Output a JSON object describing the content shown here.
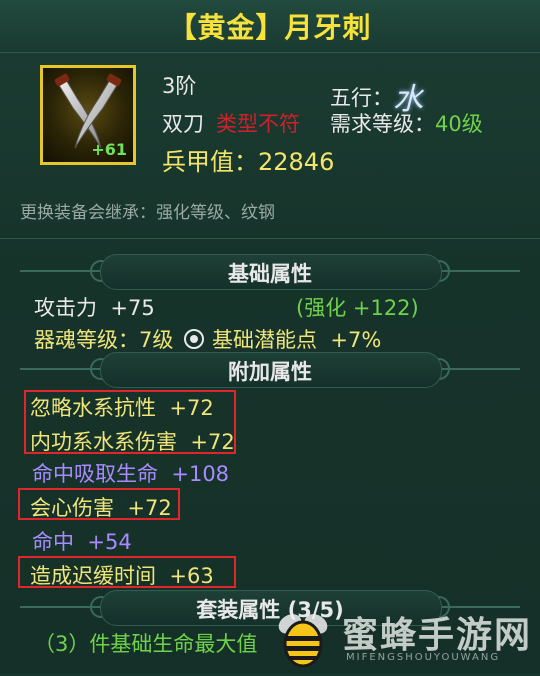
{
  "item": {
    "title": "【黄金】月牙刺",
    "level_badge": "+61",
    "tier": "3阶",
    "element_label": "五行：",
    "element_glyph": "水",
    "weapon_type": "双刀",
    "type_mismatch": "类型不符",
    "req_level_label": "需求等级：",
    "req_level_value": "40级",
    "power_label": "兵甲值：",
    "power_value": "22846",
    "inherit_note": "更换装备会继承：强化等级、纹钢"
  },
  "base": {
    "header": "基础属性",
    "attack_label": "攻击力",
    "attack_value": "+75",
    "enhance_text": "(强化 +122)",
    "soul_level": "器魂等级：7级",
    "potential_label": "基础潜能点",
    "potential_value": "+7%"
  },
  "extra": {
    "header": "附加属性",
    "attrs": [
      {
        "label": "忽略水系抗性",
        "value": "+72"
      },
      {
        "label": "内功系水系伤害",
        "value": "+72"
      },
      {
        "label": "命中吸取生命",
        "value": "+108"
      },
      {
        "label": "会心伤害",
        "value": "+72"
      },
      {
        "label": "命中",
        "value": "+54"
      },
      {
        "label": "造成迟缓时间",
        "value": "+63"
      }
    ]
  },
  "set": {
    "header": "套装属性 (3/5)",
    "bonus": "（3）件基础生命最大值"
  },
  "watermark": {
    "text": "蜜蜂手游网",
    "sub": "MIFENGSHOUYOUWANG"
  },
  "colors": {
    "title": "#f7e23b",
    "highlight_box": "#e0262a",
    "green_value": "#6fd34a",
    "purple_attr": "#a98bff",
    "yellow_attr": "#f0e57a"
  }
}
